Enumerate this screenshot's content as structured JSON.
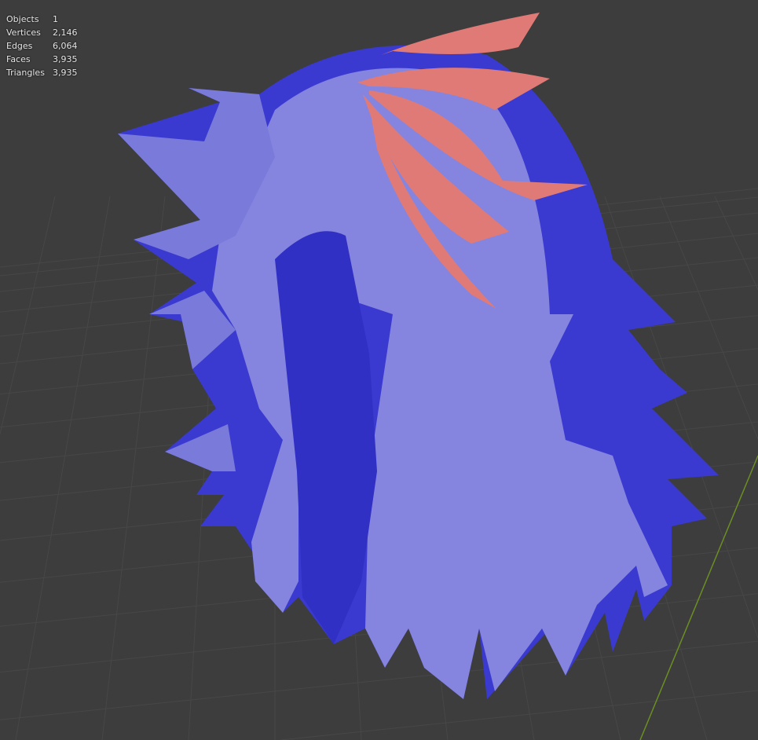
{
  "stats": [
    {
      "label": "Objects",
      "value": "1"
    },
    {
      "label": "Vertices",
      "value": "2,146"
    },
    {
      "label": "Edges",
      "value": "6,064"
    },
    {
      "label": "Faces",
      "value": "3,935"
    },
    {
      "label": "Triangles",
      "value": "3,935"
    }
  ],
  "colors": {
    "background": "#3d3d3d",
    "grid": "#4a4a4a",
    "hair_light": "#8a8ae6",
    "hair_dark": "#3232c8",
    "accent_red": "#e07070",
    "axis_y": "#6b8e23"
  }
}
